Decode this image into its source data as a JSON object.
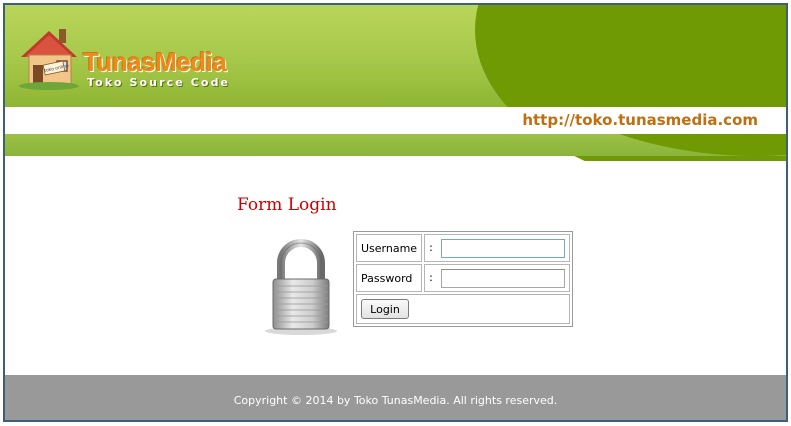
{
  "header": {
    "logo": {
      "name": "TunasMedia",
      "tagline": "Toko Source Code",
      "sign_text": "toko online"
    },
    "url": "http://toko.tunasmedia.com"
  },
  "form": {
    "title": "Form Login",
    "username_label": "Username",
    "password_label": "Password",
    "separator": ":",
    "username_value": "",
    "password_value": "",
    "login_label": "Login"
  },
  "footer": {
    "copyright": "Copyright © 2014 by Toko TunasMedia. All rights reserved."
  },
  "colors": {
    "header_green_dark": "#6f9a04",
    "header_green_light": "#b9d55a",
    "url_orange": "#c06f10",
    "title_red": "#d10000",
    "footer_gray": "#999999"
  },
  "icons": [
    "house-logo-icon",
    "padlock-icon"
  ]
}
